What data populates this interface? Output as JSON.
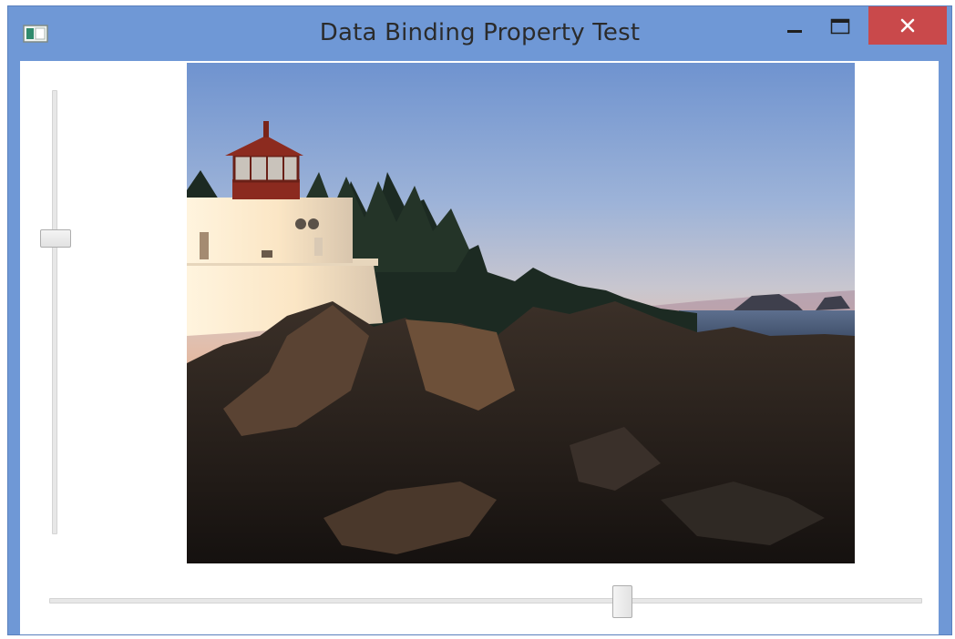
{
  "window": {
    "title": "Data Binding Property Test",
    "accent_color": "#6f98d6",
    "close_color": "#c9494b"
  },
  "title_buttons": {
    "minimize_icon": "minimize-icon",
    "maximize_icon": "maximize-icon",
    "close_icon": "close-icon"
  },
  "vertical_slider": {
    "value_fraction": 0.67
  },
  "horizontal_slider": {
    "value_fraction": 0.66
  },
  "image": {
    "subject": "lighthouse-photo"
  }
}
